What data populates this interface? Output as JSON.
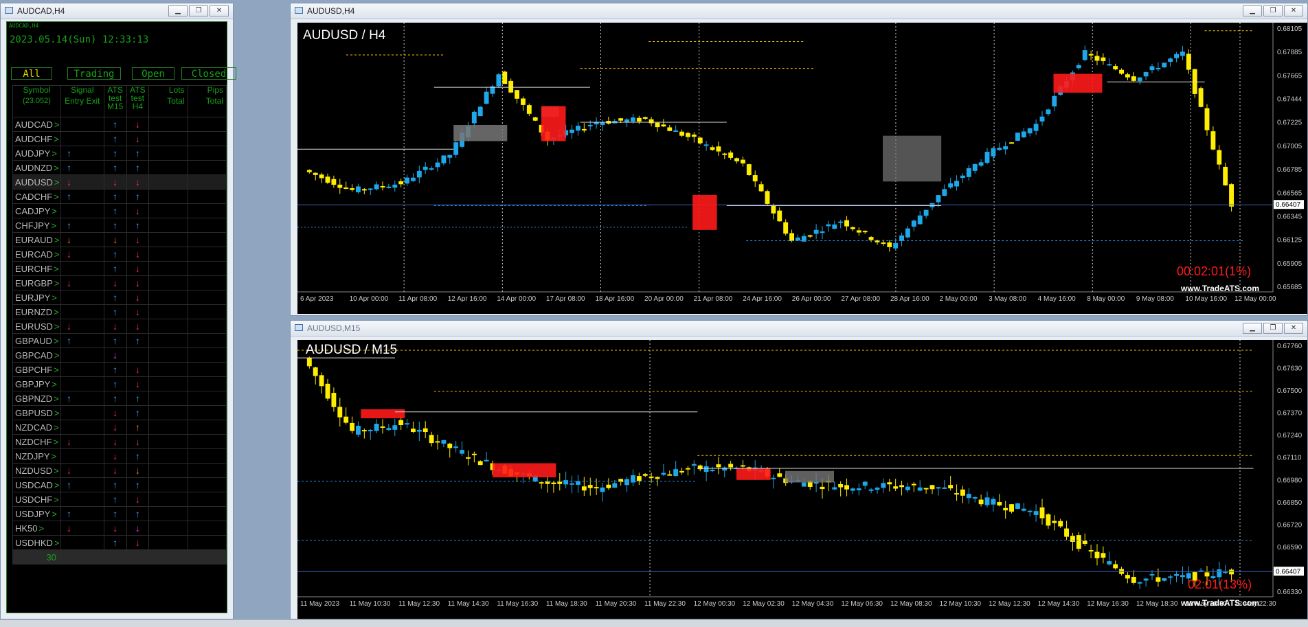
{
  "left_window": {
    "title": "AUDCAD,H4",
    "panel_label": "AUDCAD,H4",
    "datetime": "2023.05.14(Sun) 12:33:13",
    "tabs": [
      "All",
      "Trading",
      "Open",
      "Closed"
    ],
    "headers": {
      "symbol": "Symbol",
      "symbol_count": "(23.052)",
      "signal": "Signal",
      "entry_exit": "Entry Exit",
      "ats_m15_a": "ATS",
      "ats_m15_b": "test",
      "ats_m15_c": "M15",
      "ats_h4_a": "ATS",
      "ats_h4_b": "test",
      "ats_h4_c": "H4",
      "lots": "Lots",
      "lots_total": "Total",
      "pips": "Pips",
      "pips_total": "Total"
    },
    "rows": [
      {
        "symbol": "AUDCAD",
        "chev": ">",
        "signal": "",
        "m15": "up",
        "h4": "down"
      },
      {
        "symbol": "AUDCHF",
        "chev": ">",
        "signal": "",
        "m15": "up",
        "h4": "down"
      },
      {
        "symbol": "AUDJPY",
        "chev": ">",
        "signal": "up",
        "m15": "up",
        "h4": "up"
      },
      {
        "symbol": "AUDNZD",
        "chev": ">",
        "signal": "up",
        "m15": "up",
        "h4": "up"
      },
      {
        "symbol": "AUDUSD",
        "chev": ">",
        "signal": "down",
        "m15": "down",
        "h4": "down",
        "selected": true
      },
      {
        "symbol": "CADCHF",
        "chev": ">",
        "signal": "up",
        "m15": "up",
        "h4": "up"
      },
      {
        "symbol": "CADJPY",
        "chev": ">",
        "signal": "",
        "m15": "up",
        "h4": "down"
      },
      {
        "symbol": "CHFJPY",
        "chev": ">",
        "signal": "up",
        "m15": "up",
        "h4": "up"
      },
      {
        "symbol": "EURAUD",
        "chev": ">",
        "signal": "down-or",
        "m15": "down-or",
        "h4": "down"
      },
      {
        "symbol": "EURCAD",
        "chev": ">",
        "signal": "down",
        "m15": "up",
        "h4": "down"
      },
      {
        "symbol": "EURCHF",
        "chev": ">",
        "signal": "",
        "m15": "up",
        "h4": "down"
      },
      {
        "symbol": "EURGBP",
        "chev": ">",
        "signal": "down",
        "m15": "down",
        "h4": "down"
      },
      {
        "symbol": "EURJPY",
        "chev": ">",
        "signal": "",
        "m15": "up",
        "h4": "down"
      },
      {
        "symbol": "EURNZD",
        "chev": ">",
        "signal": "",
        "m15": "up",
        "h4": "down"
      },
      {
        "symbol": "EURUSD",
        "chev": ">",
        "signal": "down",
        "m15": "down",
        "h4": "down"
      },
      {
        "symbol": "GBPAUD",
        "chev": ">",
        "signal": "up",
        "m15": "up",
        "h4": "up"
      },
      {
        "symbol": "GBPCAD",
        "chev": ">",
        "signal": "",
        "m15": "mag",
        "h4": ""
      },
      {
        "symbol": "GBPCHF",
        "chev": ">",
        "signal": "",
        "m15": "up",
        "h4": "down"
      },
      {
        "symbol": "GBPJPY",
        "chev": ">",
        "signal": "",
        "m15": "up",
        "h4": "down"
      },
      {
        "symbol": "GBPNZD",
        "chev": ">",
        "signal": "up",
        "m15": "up",
        "h4": "up"
      },
      {
        "symbol": "GBPUSD",
        "chev": ">",
        "signal": "",
        "m15": "down",
        "h4": "up"
      },
      {
        "symbol": "NZDCAD",
        "chev": ">",
        "signal": "",
        "m15": "down",
        "h4": "up-or"
      },
      {
        "symbol": "NZDCHF",
        "chev": ">",
        "signal": "down",
        "m15": "down",
        "h4": "down"
      },
      {
        "symbol": "NZDJPY",
        "chev": ">",
        "signal": "",
        "m15": "down",
        "h4": "up"
      },
      {
        "symbol": "NZDUSD",
        "chev": ">",
        "signal": "down",
        "m15": "down",
        "h4": "down-or"
      },
      {
        "symbol": "USDCAD",
        "chev": ">",
        "signal": "up",
        "m15": "up",
        "h4": "up"
      },
      {
        "symbol": "USDCHF",
        "chev": ">",
        "signal": "",
        "m15": "up",
        "h4": "down"
      },
      {
        "symbol": "USDJPY",
        "chev": ">",
        "signal": "up",
        "m15": "up",
        "h4": "up"
      },
      {
        "symbol": "HK50",
        "chev": ">",
        "signal": "down",
        "m15": "down",
        "h4": "mag"
      },
      {
        "symbol": "USDHKD",
        "chev": ">",
        "signal": "",
        "m15": "up",
        "h4": "down"
      }
    ],
    "total_count": "30"
  },
  "h4_window": {
    "title": "AUDUSD,H4",
    "chart_title": "AUDUSD / H4",
    "timer": "00:02:01(1%)",
    "watermark": "www.TradeATS.com",
    "price_labels": [
      "0.68105",
      "0.67885",
      "0.67665",
      "0.67444",
      "0.67225",
      "0.67005",
      "0.66785",
      "0.66565",
      "0.66345",
      "0.66125",
      "0.65905",
      "0.65685"
    ],
    "current_price": "0.66407",
    "time_labels": [
      "6 Apr 2023",
      "10 Apr 00:00",
      "11 Apr 08:00",
      "12 Apr 16:00",
      "14 Apr 00:00",
      "17 Apr 08:00",
      "18 Apr 16:00",
      "20 Apr 00:00",
      "21 Apr 08:00",
      "24 Apr 16:00",
      "26 Apr 00:00",
      "27 Apr 08:00",
      "28 Apr 16:00",
      "2 May 00:00",
      "3 May 08:00",
      "4 May 16:00",
      "8 May 00:00",
      "9 May 08:00",
      "10 May 16:00",
      "12 May 00:00"
    ]
  },
  "m15_window": {
    "title": "AUDUSD,M15",
    "chart_title": "AUDUSD / M15",
    "timer": "02:01(13%)",
    "watermark": "www.TradeATS.com",
    "price_labels": [
      "0.67760",
      "0.67630",
      "0.67500",
      "0.67370",
      "0.67240",
      "0.67110",
      "0.66980",
      "0.66850",
      "0.66720",
      "0.66590",
      "0.66460",
      "0.66330"
    ],
    "current_price": "0.66407",
    "time_labels": [
      "11 May 2023",
      "11 May 10:30",
      "11 May 12:30",
      "11 May 14:30",
      "11 May 16:30",
      "11 May 18:30",
      "11 May 20:30",
      "11 May 22:30",
      "12 May 00:30",
      "12 May 02:30",
      "12 May 04:30",
      "12 May 06:30",
      "12 May 08:30",
      "12 May 10:30",
      "12 May 12:30",
      "12 May 14:30",
      "12 May 16:30",
      "12 May 18:30",
      "12 May 20:30",
      "12 May 22:30"
    ]
  },
  "colors": {
    "bull": "#1ea7e9",
    "bear": "#ffee00",
    "grid": "#c8c8c8",
    "panel_green": "#19a019",
    "alert_red": "#ff1a1a"
  },
  "window_buttons": {
    "minimize": "▁",
    "restore": "❐",
    "close": "✕"
  },
  "chart_data": [
    {
      "type": "line",
      "title": "AUDUSD / H4",
      "x": [
        "6 Apr 2023",
        "10 Apr 00:00",
        "11 Apr 08:00",
        "12 Apr 16:00",
        "14 Apr 00:00",
        "17 Apr 08:00",
        "18 Apr 16:00",
        "20 Apr 00:00",
        "21 Apr 08:00",
        "24 Apr 16:00",
        "26 Apr 00:00",
        "27 Apr 08:00",
        "28 Apr 16:00",
        "2 May 00:00",
        "3 May 08:00",
        "4 May 16:00",
        "8 May 00:00",
        "9 May 08:00",
        "10 May 16:00",
        "12 May 00:00"
      ],
      "series": [
        {
          "values": [
            0.6675,
            0.6655,
            0.6662,
            0.669,
            0.677,
            0.6705,
            0.6722,
            0.6725,
            0.6705,
            0.668,
            0.6605,
            0.6625,
            0.6598,
            0.665,
            0.669,
            0.672,
            0.679,
            0.6765,
            0.679,
            0.6641
          ]
        }
      ],
      "ylim": [
        0.6555,
        0.682
      ]
    },
    {
      "type": "line",
      "title": "AUDUSD / M15",
      "x": [
        "11 May 2023",
        "11 May 10:30",
        "11 May 12:30",
        "11 May 14:30",
        "11 May 16:30",
        "11 May 18:30",
        "11 May 20:30",
        "11 May 22:30",
        "12 May 00:30",
        "12 May 02:30",
        "12 May 04:30",
        "12 May 06:30",
        "12 May 08:30",
        "12 May 10:30",
        "12 May 12:30",
        "12 May 14:30",
        "12 May 16:30",
        "12 May 18:30",
        "12 May 20:30",
        "12 May 22:30"
      ],
      "series": [
        {
          "values": [
            0.6774,
            0.6728,
            0.6733,
            0.6718,
            0.6705,
            0.6696,
            0.6693,
            0.67,
            0.6705,
            0.6705,
            0.6697,
            0.6694,
            0.6694,
            0.6693,
            0.6684,
            0.6678,
            0.6655,
            0.6636,
            0.6637,
            0.6641
          ]
        }
      ],
      "ylim": [
        0.6625,
        0.6785
      ]
    }
  ]
}
